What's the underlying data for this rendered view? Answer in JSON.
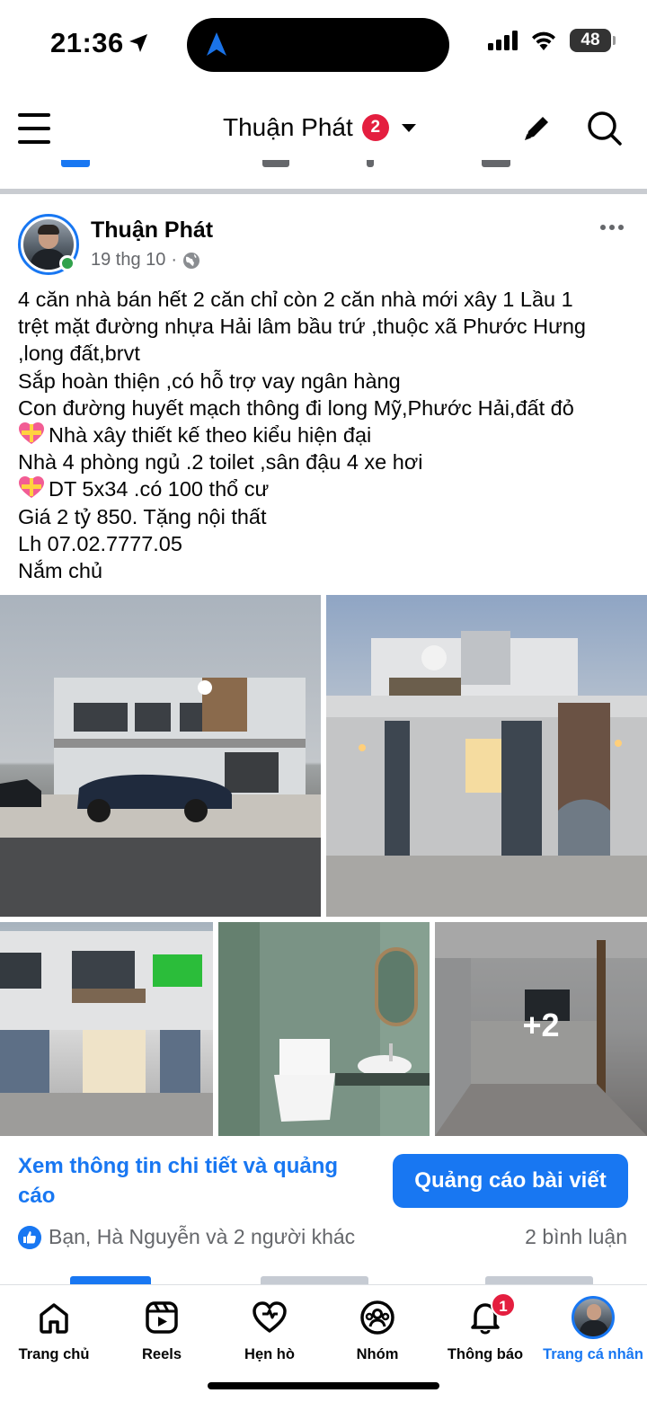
{
  "status_bar": {
    "time": "21:36",
    "battery": "48",
    "icons": [
      "location-arrow-icon",
      "navigation-icon",
      "cellular-signal-icon",
      "wifi-icon",
      "battery-icon"
    ]
  },
  "header": {
    "title": "Thuận Phát",
    "badge": "2",
    "icons": [
      "menu-icon",
      "chevron-down-icon",
      "pencil-icon",
      "search-icon"
    ]
  },
  "post": {
    "author": "Thuận Phát",
    "date": "19 thg 10",
    "dot": "·",
    "audience_icon": "globe-icon",
    "lines": [
      "4 căn nhà bán  hết 2 căn chỉ còn 2 căn nhà mới xây 1 Lầu 1",
      "trệt mặt đường nhựa Hải lâm bầu trứ ,thuộc xã Phước Hưng",
      ",long đất,brvt",
      "Sắp hoàn thiện ,có hỗ trợ vay ngân hàng",
      "Con đường huyết mạch thông đi long Mỹ,Phước Hải,đất đỏ",
      "Nhà  xây thiết kế theo kiểu hiện đại",
      "Nhà 4 phòng ngủ .2 toilet ,sân đậu 4 xe hơi",
      "DT 5x34 .có 100 thổ cư",
      "Giá 2 tỷ 850. Tặng nội thất",
      "Lh 07.02.7777.05",
      "Nắm chủ"
    ],
    "more_photos": "+2",
    "ad_link": "Xem thông tin chi tiết và quảng cáo",
    "boost_button": "Quảng cáo bài viết",
    "reactions": "Bạn, Hà Nguyễn và 2 người khác",
    "comments": "2 bình luận"
  },
  "bottom_nav": [
    {
      "label": "Trang chủ",
      "icon": "home-icon"
    },
    {
      "label": "Reels",
      "icon": "reels-icon"
    },
    {
      "label": "Hẹn hò",
      "icon": "dating-heart-icon"
    },
    {
      "label": "Nhóm",
      "icon": "groups-icon"
    },
    {
      "label": "Thông báo",
      "icon": "bell-icon",
      "badge": "1"
    },
    {
      "label": "Trang cá nhân",
      "icon": "profile-avatar-icon",
      "active": true
    }
  ],
  "colors": {
    "accent": "#1877f2",
    "badge": "#e41e3f",
    "online": "#31a24c",
    "secondary_text": "#65676b"
  }
}
